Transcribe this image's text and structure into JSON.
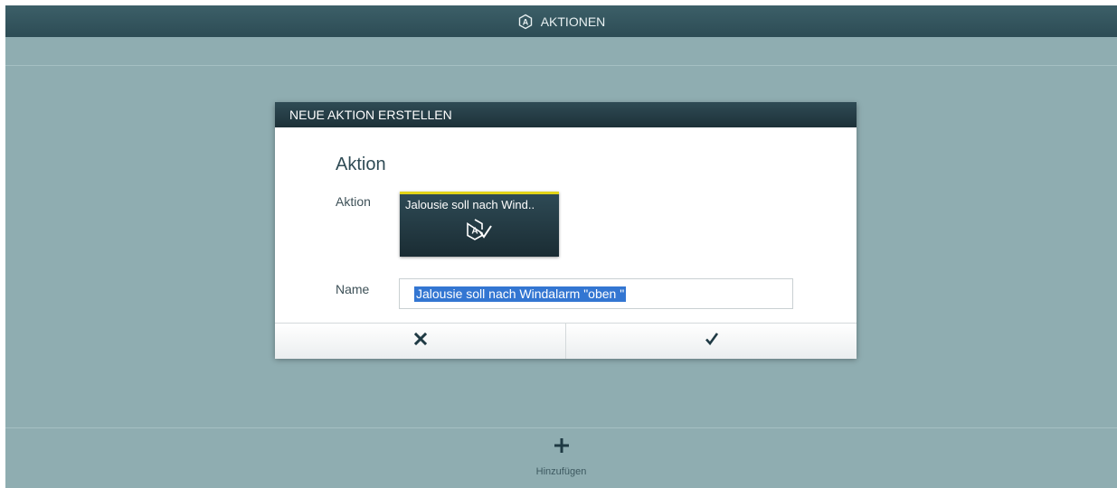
{
  "topbar": {
    "title": "AKTIONEN",
    "icon": "action-a-icon"
  },
  "dialog": {
    "header": "NEUE AKTION ERSTELLEN",
    "section_title": "Aktion",
    "action_label": "Aktion",
    "action_tile": {
      "label": "Jalousie soll nach Wind..",
      "icon": "action-check-icon",
      "accent_color": "#e2d418"
    },
    "name_label": "Name",
    "name_value": "Jalousie soll nach Windalarm \"oben \"",
    "cancel_icon": "close-icon",
    "confirm_icon": "checkmark-icon"
  },
  "bottombar": {
    "add_label": "Hinzufügen",
    "add_icon": "plus-icon"
  },
  "colors": {
    "background": "#8fadb1",
    "topbar": "#2d4c55",
    "dialog_header": "#1d3138",
    "icon_dark": "#1f3a44",
    "selection": "#3376d2"
  }
}
